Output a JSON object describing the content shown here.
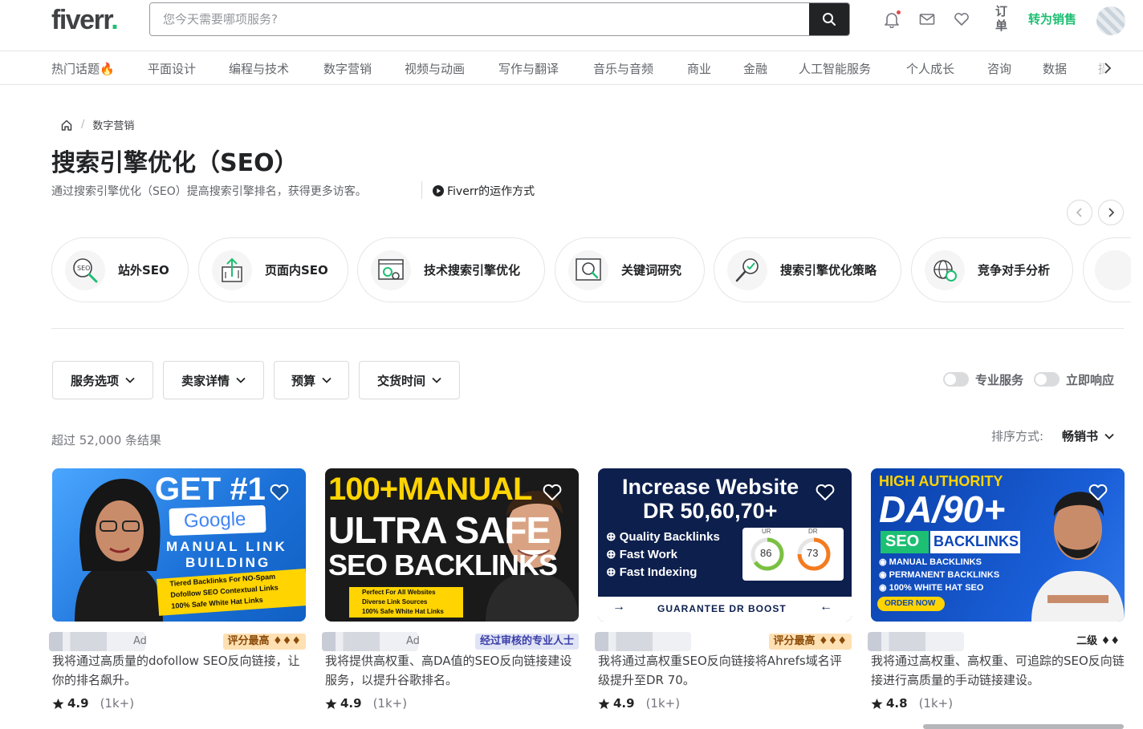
{
  "header": {
    "logo_text": "fiverr",
    "logo_dot": ".",
    "search_placeholder": "您今天需要哪项服务?",
    "orders_label": "订单",
    "become_seller": "转为销售"
  },
  "categories": [
    "热门话题🔥",
    "平面设计",
    "编程与技术",
    "数字营销",
    "视频与动画",
    "写作与翻译",
    "音乐与音频",
    "商业",
    "金融",
    "人工智能服务",
    "个人成长",
    "咨询",
    "数据",
    "摄"
  ],
  "breadcrumb": {
    "current": "数字营销"
  },
  "page": {
    "title": "搜索引擎优化（SEO）",
    "subtitle": "通过搜索引擎优化（SEO）提高搜索引擎排名，获得更多访客。",
    "how_it_works": "Fiverr的运作方式"
  },
  "subcategories": [
    {
      "label": "站外SEO",
      "icon": "seo-magnifier-icon"
    },
    {
      "label": "页面内SEO",
      "icon": "upload-page-icon"
    },
    {
      "label": "技术搜索引擎优化",
      "icon": "gear-browser-icon"
    },
    {
      "label": "关键词研究",
      "icon": "keyword-search-icon"
    },
    {
      "label": "搜索引擎优化策略",
      "icon": "strategy-magnifier-icon"
    },
    {
      "label": "竞争对手分析",
      "icon": "globe-analysis-icon"
    }
  ],
  "filters": {
    "service_options": "服务选项",
    "seller_details": "卖家详情",
    "budget": "预算",
    "delivery_time": "交货时间",
    "pro_services": "专业服务",
    "instant_response": "立即响应"
  },
  "results": {
    "count_text": "超过 52,000 条结果",
    "sort_label": "排序方式:",
    "sort_value": "畅销书"
  },
  "gigs": [
    {
      "ad": "Ad",
      "badge": "评分最高 ♦♦♦",
      "title": "我将通过高质量的dofollow SEO反向链接，让你的排名飙升。",
      "rating": "4.9",
      "reviews": "(1k+)",
      "thumb": {
        "line1": "GET #1",
        "google": "Google",
        "line2": "MANUAL LINK",
        "line3": "BUILDING",
        "b1": "Tiered Backlinks For NO-Spam",
        "b2": "Dofollow SEO Contextual Links",
        "b3": "100% Safe White Hat Links"
      }
    },
    {
      "ad": "Ad",
      "badge": "经过审核的专业人士",
      "title": "我将提供高权重、高DA值的SEO反向链接建设服务，以提升谷歌排名。",
      "rating": "4.9",
      "reviews": "(1k+)",
      "thumb": {
        "line1": "100+MANUAL",
        "line2": "ULTRA SAFE",
        "line3": "SEO BACKLINKS",
        "b1": "Perfect For All Websites",
        "b2": "Diverse Link Sources",
        "b3": "100% Safe White Hat Links"
      }
    },
    {
      "ad": "",
      "badge": "评分最高 ♦♦♦",
      "title": "我将通过高权重SEO反向链接将Ahrefs域名评级提升至DR 70。",
      "rating": "4.9",
      "reviews": "(1k+)",
      "thumb": {
        "line1": "Increase Website",
        "line2": "DR 50,60,70+",
        "b1": "Quality Backlinks",
        "b2": "Fast Work",
        "b3": "Fast Indexing",
        "ur_label": "UR",
        "ur": "86",
        "dr_label": "DR",
        "dr": "73",
        "footer": "GUARANTEE DR BOOST"
      }
    },
    {
      "ad": "",
      "badge": "二级 ♦♦",
      "title": "我将通过高权重、高权重、可追踪的SEO反向链接进行高质量的手动链接建设。",
      "rating": "4.8",
      "reviews": "(1k+)",
      "thumb": {
        "line0": "HIGH AUTHORITY",
        "line1": "DA/90+",
        "seo": "SEO",
        "backlinks": "BACKLINKS",
        "b1": "MANUAL BACKLINKS",
        "b2": "PERMANENT BACKLINKS",
        "b3": "100% WHITE HAT SEO",
        "cta": "ORDER NOW"
      }
    }
  ],
  "colors": {
    "brand_green": "#1dbf73",
    "text_dark": "#222325",
    "text_muted": "#74767e"
  }
}
